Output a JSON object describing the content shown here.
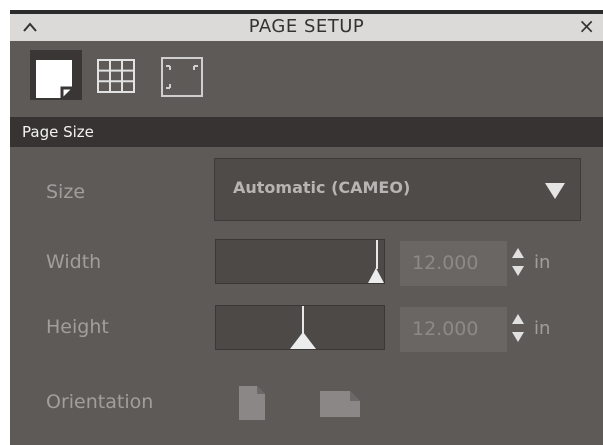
{
  "window": {
    "title": "PAGE SETUP",
    "close_glyph": "×"
  },
  "tabs": [
    {
      "name": "page-tab",
      "icon": "page-icon",
      "active": true
    },
    {
      "name": "grid-tab",
      "icon": "grid-icon",
      "active": false
    },
    {
      "name": "margins-tab",
      "icon": "corners-icon",
      "active": false
    }
  ],
  "section": {
    "title": "Page Size"
  },
  "size": {
    "label": "Size",
    "value": "Automatic (CAMEO)"
  },
  "width": {
    "label": "Width",
    "value": "12.000",
    "unit": "in",
    "slider_fraction": 0.96
  },
  "height": {
    "label": "Height",
    "value": "12.000",
    "unit": "in",
    "slider_fraction": 0.52
  },
  "orientation": {
    "label": "Orientation",
    "options": [
      "portrait",
      "landscape"
    ]
  },
  "colors": {
    "panel_bg": "#5e5a58",
    "titlebar_bg": "#dcdad9",
    "section_bg": "#373333",
    "label_text": "#a29e9c",
    "input_bg": "#4d4947"
  }
}
